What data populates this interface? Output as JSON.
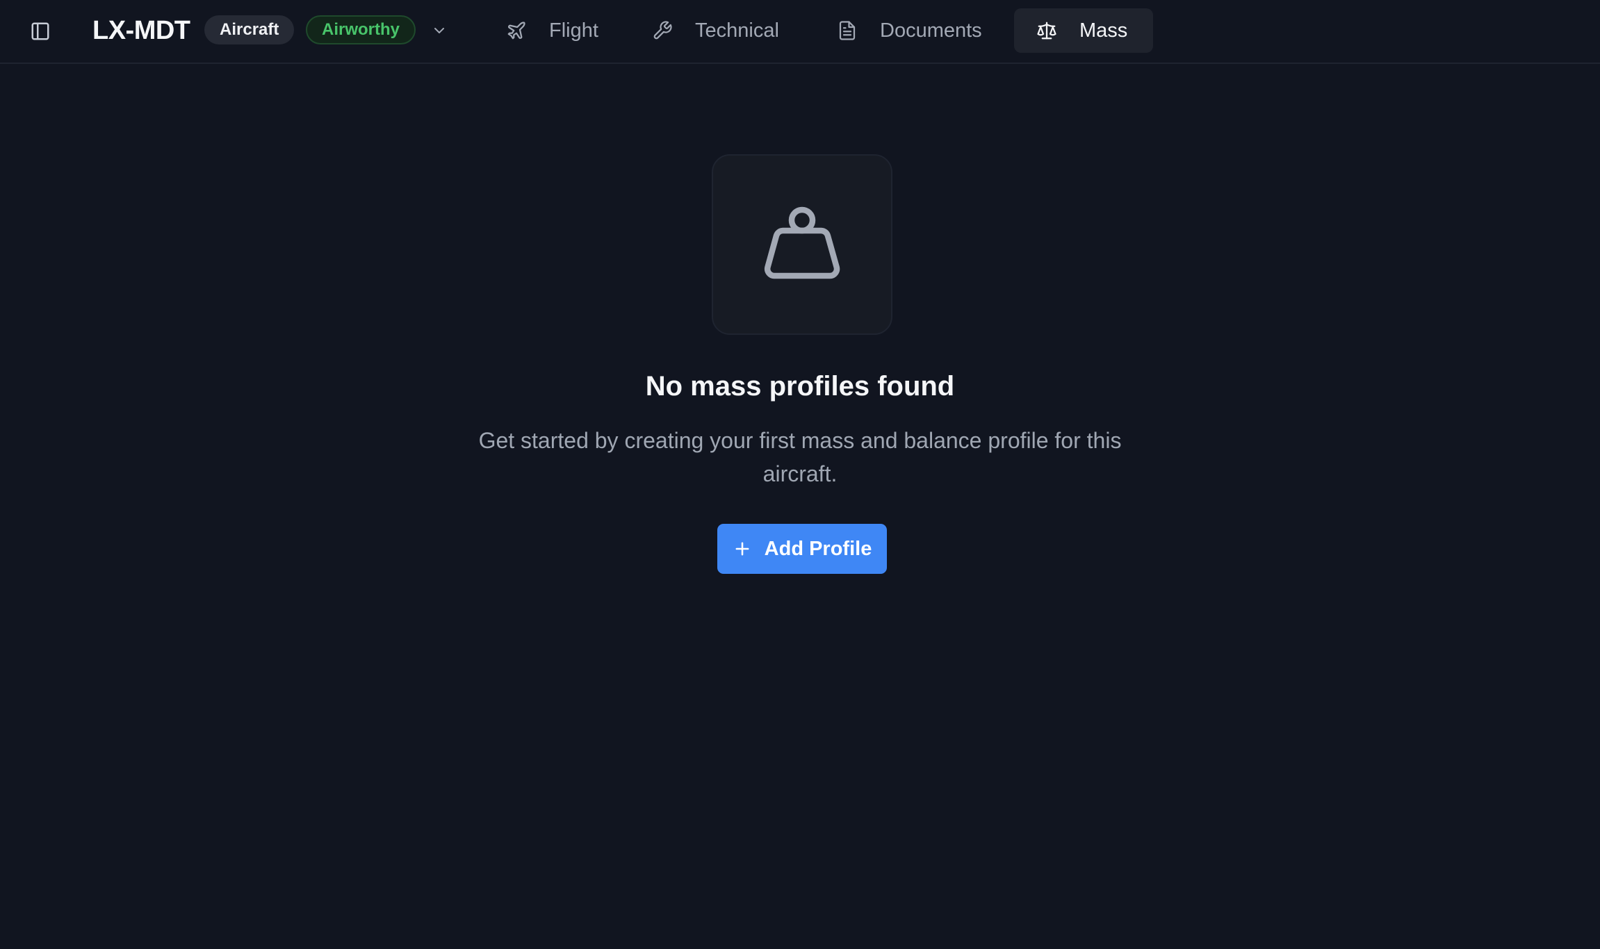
{
  "header": {
    "tail_number": "LX-MDT",
    "type_badge": "Aircraft",
    "status_badge": "Airworthy",
    "status_color": "#48c46a",
    "icons": {
      "sidebar_toggle": "sidebar-toggle-icon",
      "status_dropdown": "chevron-down-icon"
    }
  },
  "tabs": [
    {
      "label": "Flight",
      "icon": "plane-icon",
      "active": false
    },
    {
      "label": "Technical",
      "icon": "wrench-icon",
      "active": false
    },
    {
      "label": "Documents",
      "icon": "document-icon",
      "active": false
    },
    {
      "label": "Mass",
      "icon": "scale-icon",
      "active": true
    }
  ],
  "empty_state": {
    "icon": "weight-icon",
    "title": "No mass profiles found",
    "description": "Get started by creating your first mass and balance profile for this aircraft.",
    "button_label": "Add Profile",
    "button_icon": "plus-icon",
    "accent_color": "#3f87f5"
  }
}
